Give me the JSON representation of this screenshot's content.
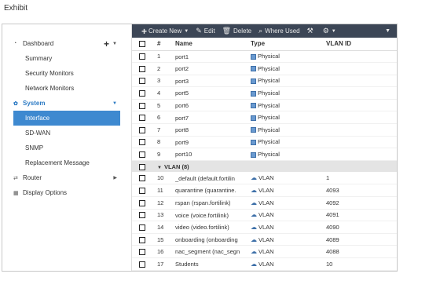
{
  "exhibit_label": "Exhibit",
  "sidebar": {
    "dashboard": {
      "label": "Dashboard",
      "summary": "Summary",
      "security_monitors": "Security Monitors",
      "network_monitors": "Network Monitors"
    },
    "system": {
      "label": "System",
      "items": [
        "Interface",
        "SD-WAN",
        "SNMP",
        "Replacement Message"
      ],
      "active": "Interface"
    },
    "router": {
      "label": "Router"
    },
    "display_options": {
      "label": "Display Options"
    }
  },
  "toolbar": {
    "create_new": "Create New",
    "edit": "Edit",
    "delete": "Delete",
    "where_used": "Where Used"
  },
  "table": {
    "headers": {
      "num": "#",
      "name": "Name",
      "type": "Type",
      "vlan_id": "VLAN ID"
    },
    "physical_rows": [
      {
        "num": "1",
        "name": "port1",
        "type": "Physical",
        "vlan_id": ""
      },
      {
        "num": "2",
        "name": "port2",
        "type": "Physical",
        "vlan_id": ""
      },
      {
        "num": "3",
        "name": "port3",
        "type": "Physical",
        "vlan_id": ""
      },
      {
        "num": "4",
        "name": "port5",
        "type": "Physical",
        "vlan_id": ""
      },
      {
        "num": "5",
        "name": "port6",
        "type": "Physical",
        "vlan_id": ""
      },
      {
        "num": "6",
        "name": "port7",
        "type": "Physical",
        "vlan_id": ""
      },
      {
        "num": "7",
        "name": "port8",
        "type": "Physical",
        "vlan_id": ""
      },
      {
        "num": "8",
        "name": "port9",
        "type": "Physical",
        "vlan_id": ""
      },
      {
        "num": "9",
        "name": "port10",
        "type": "Physical",
        "vlan_id": ""
      }
    ],
    "vlan_group_label": "VLAN (8)",
    "vlan_rows": [
      {
        "num": "10",
        "name": "_default (default.fortilin",
        "type": "VLAN",
        "vlan_id": "1"
      },
      {
        "num": "11",
        "name": "quarantine (quarantine.",
        "type": "VLAN",
        "vlan_id": "4093"
      },
      {
        "num": "12",
        "name": "rspan (rspan.fortilink)",
        "type": "VLAN",
        "vlan_id": "4092"
      },
      {
        "num": "13",
        "name": "voice (voice.fortilink)",
        "type": "VLAN",
        "vlan_id": "4091"
      },
      {
        "num": "14",
        "name": "video (video.fortilink)",
        "type": "VLAN",
        "vlan_id": "4090"
      },
      {
        "num": "15",
        "name": "onboarding (onboarding",
        "type": "VLAN",
        "vlan_id": "4089"
      },
      {
        "num": "16",
        "name": "nac_segment (nac_segn",
        "type": "VLAN",
        "vlan_id": "4088"
      },
      {
        "num": "17",
        "name": "Students",
        "type": "VLAN",
        "vlan_id": "10"
      }
    ]
  },
  "colors": {
    "toolbar_bg": "#3c4656",
    "active_nav": "#3e89d0",
    "accent_blue": "#2d7bc4",
    "group_row_bg": "#e4e4e4"
  }
}
